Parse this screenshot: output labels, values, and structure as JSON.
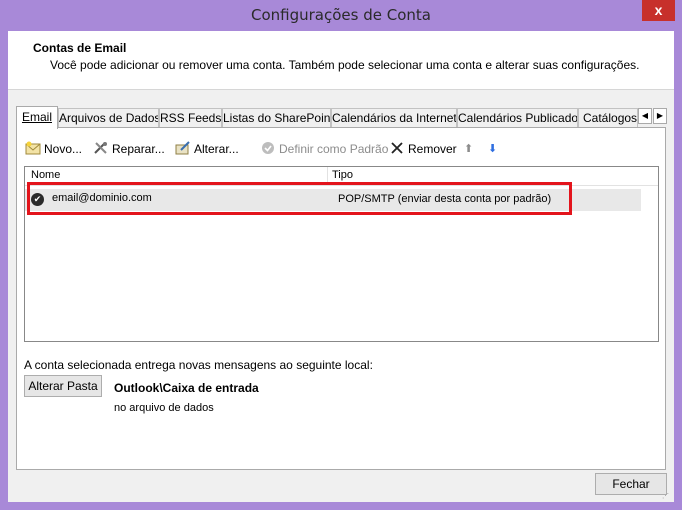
{
  "window": {
    "title": "Configurações de Conta",
    "close_glyph": "x",
    "accent": "#a889d8"
  },
  "header": {
    "title": "Contas de Email",
    "description": "Você pode adicionar ou remover uma conta. Também pode selecionar uma conta e alterar suas configurações."
  },
  "tabs": [
    {
      "label": "Email",
      "active": true
    },
    {
      "label": "Arquivos de Dados"
    },
    {
      "label": "RSS Feeds"
    },
    {
      "label": "Listas do SharePoint"
    },
    {
      "label": "Calendários da Internet"
    },
    {
      "label": "Calendários Publicados"
    },
    {
      "label": "Catálogos"
    }
  ],
  "tab_scroll": {
    "left": "◀",
    "right": "▶"
  },
  "toolbar": {
    "new": "Novo...",
    "repair": "Reparar...",
    "change": "Alterar...",
    "set_default": "Definir como Padrão",
    "remove": "Remover",
    "up_glyph": "⬆",
    "down_glyph": "⬇"
  },
  "list": {
    "columns": [
      "Nome",
      "Tipo"
    ],
    "rows": [
      {
        "name": "email@dominio.com",
        "type": "POP/SMTP (enviar desta conta por padrão)",
        "icon": "check-circle-icon"
      }
    ]
  },
  "delivery": {
    "label": "A conta selecionada entrega novas mensagens ao seguinte local:",
    "change_folder": "Alterar Pasta",
    "folder_path": "Outlook\\Caixa de entrada",
    "folder_sub": "no arquivo de dados"
  },
  "footer": {
    "close": "Fechar"
  },
  "colors": {
    "highlight": "#e3141c",
    "close_button": "#c7302b",
    "down_arrow": "#2f6ee0"
  }
}
